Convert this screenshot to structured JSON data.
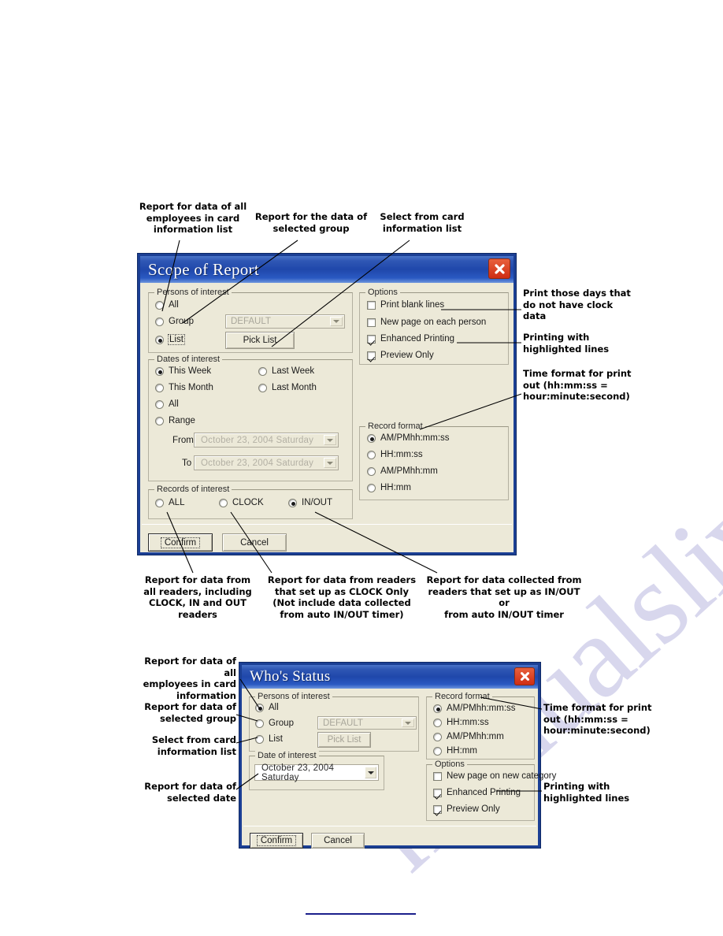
{
  "page": {
    "watermark": "manualslive.com"
  },
  "dialog1": {
    "title": "Scope of Report",
    "close_icon": "close-icon",
    "persons": {
      "legend": "Persons of interest",
      "options": [
        {
          "label": "All",
          "selected": false
        },
        {
          "label": "Group",
          "selected": false
        },
        {
          "label": "List",
          "selected": true
        }
      ],
      "group_combo_value": "DEFAULT",
      "pick_list_button": "Pick List"
    },
    "dates": {
      "legend": "Dates of interest",
      "options": [
        {
          "label": "This Week",
          "selected": true
        },
        {
          "label": "Last Week",
          "selected": false
        },
        {
          "label": "This Month",
          "selected": false
        },
        {
          "label": "Last Month",
          "selected": false
        },
        {
          "label": "All",
          "selected": false
        },
        {
          "label": "Range",
          "selected": false
        }
      ],
      "from_label": "From",
      "from_value": "October   23, 2004   Saturday",
      "to_label": "To",
      "to_value": "October   23, 2004   Saturday"
    },
    "records": {
      "legend": "Records of interest",
      "options": [
        {
          "label": "ALL",
          "selected": false
        },
        {
          "label": "CLOCK",
          "selected": false
        },
        {
          "label": "IN/OUT",
          "selected": true
        }
      ]
    },
    "options": {
      "legend": "Options",
      "items": [
        {
          "label": "Print blank lines",
          "checked": false
        },
        {
          "label": "New page on each person",
          "checked": false
        },
        {
          "label": "Enhanced Printing",
          "checked": true
        },
        {
          "label": "Preview Only",
          "checked": true
        }
      ]
    },
    "record_format": {
      "legend": "Record format",
      "options": [
        {
          "label": "AM/PMhh:mm:ss",
          "selected": true
        },
        {
          "label": "HH:mm:ss",
          "selected": false
        },
        {
          "label": "AM/PMhh:mm",
          "selected": false
        },
        {
          "label": "HH:mm",
          "selected": false
        }
      ]
    },
    "buttons": {
      "confirm": "Confirm",
      "cancel": "Cancel"
    }
  },
  "dialog2": {
    "title": "Who's Status",
    "close_icon": "close-icon",
    "persons": {
      "legend": "Persons of interest",
      "options": [
        {
          "label": "All",
          "selected": true
        },
        {
          "label": "Group",
          "selected": false
        },
        {
          "label": "List",
          "selected": false
        }
      ],
      "group_combo_value": "DEFAULT",
      "pick_list_button": "Pick List"
    },
    "date": {
      "legend": "Date of interest",
      "value": "October   23, 2004   Saturday"
    },
    "record_format": {
      "legend": "Record format",
      "options": [
        {
          "label": "AM/PMhh:mm:ss",
          "selected": true
        },
        {
          "label": "HH:mm:ss",
          "selected": false
        },
        {
          "label": "AM/PMhh:mm",
          "selected": false
        },
        {
          "label": "HH:mm",
          "selected": false
        }
      ]
    },
    "options": {
      "legend": "Options",
      "items": [
        {
          "label": "New page on new category",
          "checked": false
        },
        {
          "label": "Enhanced Printing",
          "checked": true
        },
        {
          "label": "Preview Only",
          "checked": true
        }
      ]
    },
    "buttons": {
      "confirm": "Confirm",
      "cancel": "Cancel"
    }
  },
  "annotations": {
    "top1": "Report for data of all\nemployees in card\ninformation list",
    "top2": "Report for the data of\nselected group",
    "top3": "Select from card\ninformation list",
    "right1": "Print those days that\ndo not have clock\ndata",
    "right2": "Printing with\nhighlighted lines",
    "right3": "Time format for print\nout (hh:mm:ss =\nhour:minute:second)",
    "bottom1": "Report for data from\nall readers, including\nCLOCK, IN and OUT\nreaders",
    "bottom2": "Report for data from readers\nthat set up as CLOCK Only\n(Not include data collected\nfrom auto IN/OUT timer)",
    "bottom3": "Report for data collected from\nreaders that set up as IN/OUT or\nfrom auto IN/OUT timer",
    "d2left1": "Report for data of all\nemployees in card\ninformation",
    "d2left2": "Report for data of\nselected group",
    "d2left3": "Select from card\ninformation list",
    "d2left4": "Report for data of\nselected date",
    "d2right1": "Time format for print\nout (hh:mm:ss =\nhour:minute:second)",
    "d2right2": "Printing with\nhighlighted lines"
  }
}
